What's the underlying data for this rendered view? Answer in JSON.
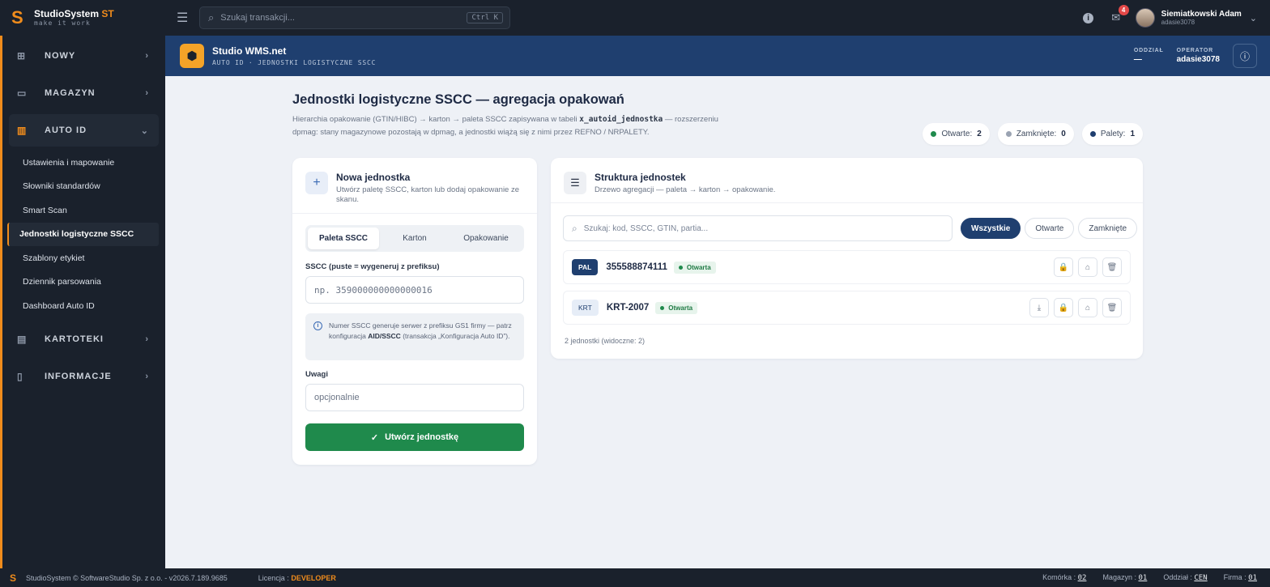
{
  "app": {
    "brand_name": "StudioSystem",
    "brand_suffix": "ST",
    "brand_tagline": "make it work",
    "search_placeholder": "Szukaj transakcji...",
    "search_shortcut": "Ctrl K",
    "notifications_count": "4",
    "user_name": "Siemiatkowski Adam",
    "user_login": "adasie3078"
  },
  "sidebar": {
    "groups": [
      {
        "label": "NOWY",
        "icon": "plus-square-icon"
      },
      {
        "label": "MAGAZYN",
        "icon": "shelf-icon"
      },
      {
        "label": "AUTO ID",
        "icon": "barcode-icon"
      },
      {
        "label": "KARTOTEKI",
        "icon": "list-box-icon"
      },
      {
        "label": "INFORMACJE",
        "icon": "document-icon"
      }
    ],
    "auto_id_items": [
      "Ustawienia i mapowanie",
      "Słowniki standardów",
      "Smart Scan",
      "Jednostki logistyczne SSCC",
      "Szablony etykiet",
      "Dziennik parsowania",
      "Dashboard Auto ID"
    ]
  },
  "header": {
    "title": "Studio WMS.net",
    "subtitle": "AUTO ID · JEDNOSTKI LOGISTYCZNE SSCC",
    "oddzial_label": "ODDZIAŁ",
    "oddzial_value": "—",
    "operator_label": "OPERATOR",
    "operator_value": "adasie3078"
  },
  "page": {
    "title": "Jednostki logistyczne SSCC — agregacja opakowań",
    "desc_part1": "Hierarchia opakowanie (GTIN/HIBC) → karton → paleta SSCC zapisywana w tabeli ",
    "desc_table": "x_autoid_jednostka",
    "desc_part2": " — rozszerzeniu dpmag: stany magazynowe pozostają w dpmag, a jednostki wiążą się z nimi przez REFNO / NRPALETY.",
    "stats": [
      {
        "label": "Otwarte:",
        "value": "2",
        "color": "#1f8a4c"
      },
      {
        "label": "Zamknięte:",
        "value": "0",
        "color": "#9aa3b2"
      },
      {
        "label": "Palety:",
        "value": "1",
        "color": "#1f3f6f"
      }
    ]
  },
  "new_unit": {
    "title": "Nowa jednostka",
    "subtitle": "Utwórz paletę SSCC, karton lub dodaj opakowanie ze skanu.",
    "tabs": [
      "Paleta SSCC",
      "Karton",
      "Opakowanie"
    ],
    "sscc_label": "SSCC (puste = wygeneruj z prefiksu)",
    "sscc_placeholder": "np. 359000000000000016",
    "note_part1": "Numer SSCC generuje serwer z prefiksu GS1 firmy — patrz konfiguracja ",
    "note_bold": "AID/SSCC",
    "note_part2": " (transakcja „Konfiguracja Auto ID”).",
    "notes_label": "Uwagi",
    "notes_placeholder": "opcjonalnie",
    "create_button": "Utwórz jednostkę"
  },
  "structure": {
    "title": "Struktura jednostek",
    "subtitle": "Drzewo agregacji — paleta → karton → opakowanie.",
    "search_placeholder": "Szukaj: kod, SSCC, GTIN, partia...",
    "filters": [
      "Wszystkie",
      "Otwarte",
      "Zamknięte"
    ],
    "rows": [
      {
        "type": "PAL",
        "code": "355588874111",
        "status": "Otwarta"
      },
      {
        "type": "KRT",
        "code": "KRT-2007",
        "status": "Otwarta"
      }
    ],
    "count_text": "2 jednostki (widoczne: 2)"
  },
  "statusbar": {
    "copyright": "StudioSystem © SoftwareStudio Sp. z o.o. - v2026.7.189.9685",
    "license_label": "Licencja :",
    "license_value": "DEVELOPER",
    "komorka_label": "Komórka :",
    "komorka_value": "02",
    "magazyn_label": "Magazyn :",
    "magazyn_value": "01",
    "oddzial_label": "Oddział :",
    "oddzial_value": "CEN",
    "firma_label": "Firma :",
    "firma_value": "01"
  },
  "colors": {
    "accent": "#f08c1c",
    "header_band": "#1f3f6f",
    "primary_green": "#1f8a4c",
    "sidebar_bg": "#1a212c"
  }
}
